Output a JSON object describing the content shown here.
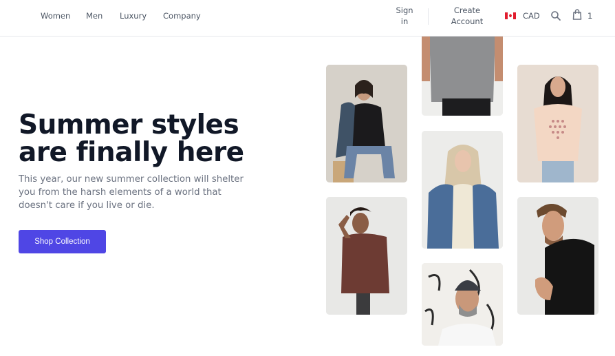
{
  "nav": {
    "links": [
      "Women",
      "Men",
      "Luxury",
      "Company"
    ]
  },
  "account": {
    "sign_in": "Sign in",
    "create_account": "Create Account"
  },
  "currency": {
    "code": "CAD",
    "flag": "canada-flag"
  },
  "cart": {
    "count": "1"
  },
  "icons": {
    "search": "search-icon",
    "cart": "shopping-bag-icon"
  },
  "hero": {
    "title": "Summer styles are finally here",
    "description": "This year, our new summer collection will shelter you from the harsh elements of a world that doesn't care if you live or die.",
    "cta": "Shop Collection"
  },
  "colors": {
    "accent": "#4f46e5",
    "heading": "#111827",
    "body_text": "#6b7280"
  },
  "gallery": [
    "woman-denim-jacket-photo",
    "man-brown-tee-photo",
    "man-gray-tee-photo",
    "woman-denim-jacket-blonde-photo",
    "man-beanie-photo",
    "woman-peach-tee-photo",
    "man-black-tee-photo"
  ]
}
